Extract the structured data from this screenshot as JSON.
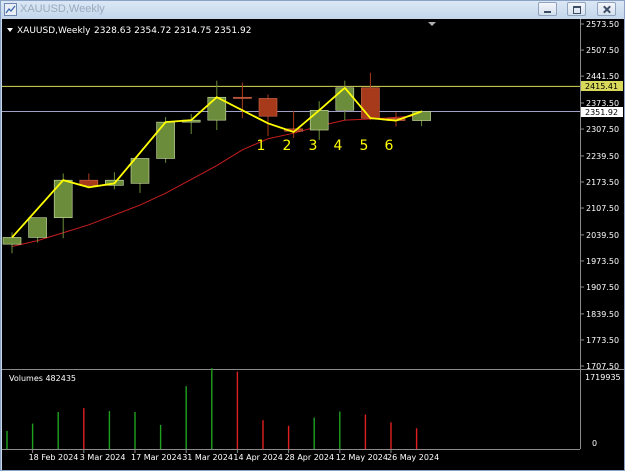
{
  "window": {
    "title": "XAUUSD,Weekly"
  },
  "chart": {
    "header": {
      "symbol": "XAUUSD,Weekly",
      "ohlc": "2328.63 2354.72 2314.75 2351.92"
    },
    "volume_label": "Volumes 482435",
    "volume_scale_top": "1719935",
    "volume_scale_zero": "0",
    "price_ticks": [
      "2573.50",
      "2507.50",
      "2441.50",
      "2373.50",
      "2307.50",
      "2239.50",
      "2173.50",
      "2107.50",
      "2039.50",
      "1973.50",
      "1907.50",
      "1839.50",
      "1773.50",
      "1707.50"
    ],
    "level_labels": [
      "2415.41",
      "2351.92"
    ],
    "date_labels": [
      "18 Feb 2024",
      "3 Mar 2024",
      "17 Mar 2024",
      "31 Mar 2024",
      "14 Apr 2024",
      "28 Apr 2024",
      "12 May 2024",
      "26 May 2024"
    ],
    "swing_labels": [
      "1",
      "2",
      "3",
      "4",
      "5",
      "6"
    ],
    "colors": {
      "background": "#000000",
      "bull": "#6b8c3a",
      "bear": "#a83a1c",
      "zigzag": "#ffff00",
      "ma": "#c81e1e",
      "hline": "#d8d85a",
      "price_line": "#a0a0c8",
      "vol_up": "#1fa01f",
      "vol_down": "#e02020"
    }
  },
  "chart_data": {
    "type": "candlestick",
    "title": "XAUUSD,Weekly",
    "ylim": [
      1707.5,
      2573.5
    ],
    "x": [
      "2024-02-11",
      "2024-02-18",
      "2024-02-25",
      "2024-03-03",
      "2024-03-10",
      "2024-03-17",
      "2024-03-24",
      "2024-03-31",
      "2024-04-07",
      "2024-04-14",
      "2024-04-21",
      "2024-04-28",
      "2024-05-05",
      "2024-05-12",
      "2024-05-19",
      "2024-05-26",
      "2024-06-02"
    ],
    "open": [
      2016,
      2033,
      2083,
      2178,
      2165,
      2170,
      2233,
      2325,
      2330,
      2388,
      2385,
      2308,
      2305,
      2355,
      2412,
      2335,
      2329
    ],
    "high": [
      2046,
      2069,
      2195,
      2195,
      2198,
      2223,
      2338,
      2346,
      2430,
      2425,
      2395,
      2353,
      2378,
      2430,
      2450,
      2350,
      2355
    ],
    "low": [
      1993,
      2020,
      2031,
      2158,
      2155,
      2146,
      2222,
      2295,
      2305,
      2335,
      2290,
      2285,
      2280,
      2330,
      2330,
      2314,
      2315
    ],
    "close": [
      2033,
      2083,
      2178,
      2165,
      2178,
      2233,
      2325,
      2330,
      2388,
      2385,
      2340,
      2302,
      2355,
      2412,
      2335,
      2329,
      2352
    ],
    "ma": [
      2010,
      2025,
      2045,
      2065,
      2090,
      2115,
      2145,
      2180,
      2215,
      2255,
      2283,
      2297,
      2315,
      2330,
      2333,
      2337,
      2342
    ],
    "zigzag": [
      {
        "x": "2024-02-11",
        "y": 2033
      },
      {
        "x": "2024-02-25",
        "y": 2178
      },
      {
        "x": "2024-03-03",
        "y": 2160
      },
      {
        "x": "2024-03-10",
        "y": 2170
      },
      {
        "x": "2024-03-24",
        "y": 2325
      },
      {
        "x": "2024-03-31",
        "y": 2330
      },
      {
        "x": "2024-04-07",
        "y": 2388
      },
      {
        "x": "2024-04-21",
        "y": 2322
      },
      {
        "x": "2024-04-28",
        "y": 2300
      },
      {
        "x": "2024-05-05",
        "y": 2355
      },
      {
        "x": "2024-05-12",
        "y": 2412
      },
      {
        "x": "2024-05-19",
        "y": 2335
      },
      {
        "x": "2024-05-26",
        "y": 2329
      },
      {
        "x": "2024-06-02",
        "y": 2352
      }
    ],
    "hlines": [
      2415.41,
      2351.92
    ],
    "volume": {
      "ylim": [
        0,
        1719935
      ],
      "values": [
        420000,
        590000,
        860000,
        950000,
        880000,
        860000,
        560000,
        1460000,
        1880000,
        1800000,
        670000,
        540000,
        730000,
        870000,
        800000,
        620000,
        482435
      ],
      "direction": [
        "up",
        "up",
        "up",
        "down",
        "up",
        "up",
        "up",
        "up",
        "up",
        "down",
        "down",
        "down",
        "up",
        "up",
        "down",
        "down",
        "down"
      ]
    }
  }
}
